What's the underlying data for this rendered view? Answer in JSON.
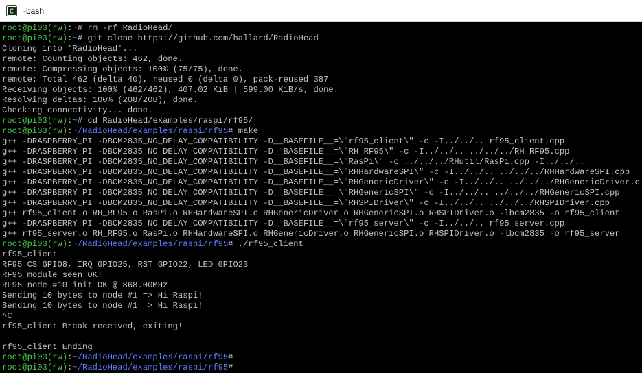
{
  "window": {
    "title": "-bash",
    "icon": "terminal-app-icon"
  },
  "colors": {
    "background": "#000000",
    "foreground": "#c0c0c0",
    "prompt_user": "#4ec94e",
    "prompt_path": "#5a7fff"
  },
  "terminal": {
    "lines": [
      {
        "type": "prompt",
        "user": "root@pi03(rw)",
        "path": "~",
        "end": "#",
        "cmd": " rm -rf RadioHead/"
      },
      {
        "type": "prompt",
        "user": "root@pi03(rw)",
        "path": "~",
        "end": "#",
        "cmd": " git clone https://github.com/hallard/RadioHead"
      },
      {
        "type": "text",
        "text": "Cloning into 'RadioHead'..."
      },
      {
        "type": "text",
        "text": "remote: Counting objects: 462, done."
      },
      {
        "type": "text",
        "text": "remote: Compressing objects: 100% (75/75), done."
      },
      {
        "type": "text",
        "text": "remote: Total 462 (delta 40), reused 0 (delta 0), pack-reused 387"
      },
      {
        "type": "text",
        "text": "Receiving objects: 100% (462/462), 407.02 KiB | 599.00 KiB/s, done."
      },
      {
        "type": "text",
        "text": "Resolving deltas: 100% (208/208), done."
      },
      {
        "type": "text",
        "text": "Checking connectivity... done."
      },
      {
        "type": "prompt",
        "user": "root@pi03(rw)",
        "path": "~",
        "end": "#",
        "cmd": " cd RadioHead/examples/raspi/rf95/"
      },
      {
        "type": "prompt",
        "user": "root@pi03(rw)",
        "path": "~/RadioHead/examples/raspi/rf95",
        "end": "#",
        "cmd": " make"
      },
      {
        "type": "text",
        "text": "g++ -DRASPBERRY_PI -DBCM2835_NO_DELAY_COMPATIBILITY -D__BASEFILE__=\\\"rf95_client\\\" -c -I../../.. rf95_client.cpp"
      },
      {
        "type": "text",
        "text": "g++ -DRASPBERRY_PI -DBCM2835_NO_DELAY_COMPATIBILITY -D__BASEFILE__=\\\"RH_RF95\\\" -c -I../../.. ../../../RH_RF95.cpp"
      },
      {
        "type": "text",
        "text": "g++ -DRASPBERRY_PI -DBCM2835_NO_DELAY_COMPATIBILITY -D__BASEFILE__=\\\"RasPi\\\" -c ../../../RHutil/RasPi.cpp -I../../.."
      },
      {
        "type": "text",
        "text": "g++ -DRASPBERRY_PI -DBCM2835_NO_DELAY_COMPATIBILITY -D__BASEFILE__=\\\"RHHardwareSPI\\\" -c -I../../.. ../../../RHHardwareSPI.cpp"
      },
      {
        "type": "text",
        "text": "g++ -DRASPBERRY_PI -DBCM2835_NO_DELAY_COMPATIBILITY -D__BASEFILE__=\\\"RHGenericDriver\\\" -c -I../../.. ../../../RHGenericDriver.cpp"
      },
      {
        "type": "text",
        "text": "g++ -DRASPBERRY_PI -DBCM2835_NO_DELAY_COMPATIBILITY -D__BASEFILE__=\\\"RHGenericSPI\\\" -c -I../../.. ../../../RHGenericSPI.cpp"
      },
      {
        "type": "text",
        "text": "g++ -DRASPBERRY_PI -DBCM2835_NO_DELAY_COMPATIBILITY -D__BASEFILE__=\\\"RHSPIDriver\\\" -c -I../../.. ../../../RHSPIDriver.cpp"
      },
      {
        "type": "text",
        "text": "g++ rf95_client.o RH_RF95.o RasPi.o RHHardwareSPI.o RHGenericDriver.o RHGenericSPI.o RHSPIDriver.o -lbcm2835 -o rf95_client"
      },
      {
        "type": "text",
        "text": "g++ -DRASPBERRY_PI -DBCM2835_NO_DELAY_COMPATIBILITY -D__BASEFILE__=\\\"rf95_server\\\" -c -I../../.. rf95_server.cpp"
      },
      {
        "type": "text",
        "text": "g++ rf95_server.o RH_RF95.o RasPi.o RHHardwareSPI.o RHGenericDriver.o RHGenericSPI.o RHSPIDriver.o -lbcm2835 -o rf95_server"
      },
      {
        "type": "prompt",
        "user": "root@pi03(rw)",
        "path": "~/RadioHead/examples/raspi/rf95",
        "end": "#",
        "cmd": " ./rf95_client"
      },
      {
        "type": "text",
        "text": "rf95_client"
      },
      {
        "type": "text",
        "text": "RF95 CS=GPIO8, IRQ=GPIO25, RST=GPIO22, LED=GPIO23"
      },
      {
        "type": "text",
        "text": "RF95 module seen OK!"
      },
      {
        "type": "text",
        "text": "RF95 node #10 init OK @ 868.00MHz"
      },
      {
        "type": "text",
        "text": "Sending 10 bytes to node #1 => Hi Raspi!"
      },
      {
        "type": "text",
        "text": "Sending 10 bytes to node #1 => Hi Raspi!"
      },
      {
        "type": "text",
        "text": "^C"
      },
      {
        "type": "text",
        "text": "rf95_client Break received, exiting!"
      },
      {
        "type": "text",
        "text": ""
      },
      {
        "type": "text",
        "text": "rf95_client Ending"
      },
      {
        "type": "prompt",
        "user": "root@pi03(rw)",
        "path": "~/RadioHead/examples/raspi/rf95",
        "end": "#",
        "cmd": ""
      },
      {
        "type": "prompt",
        "user": "root@pi03(rw)",
        "path": "~/RadioHead/examples/raspi/rf95",
        "end": "#",
        "cmd": ""
      }
    ]
  }
}
